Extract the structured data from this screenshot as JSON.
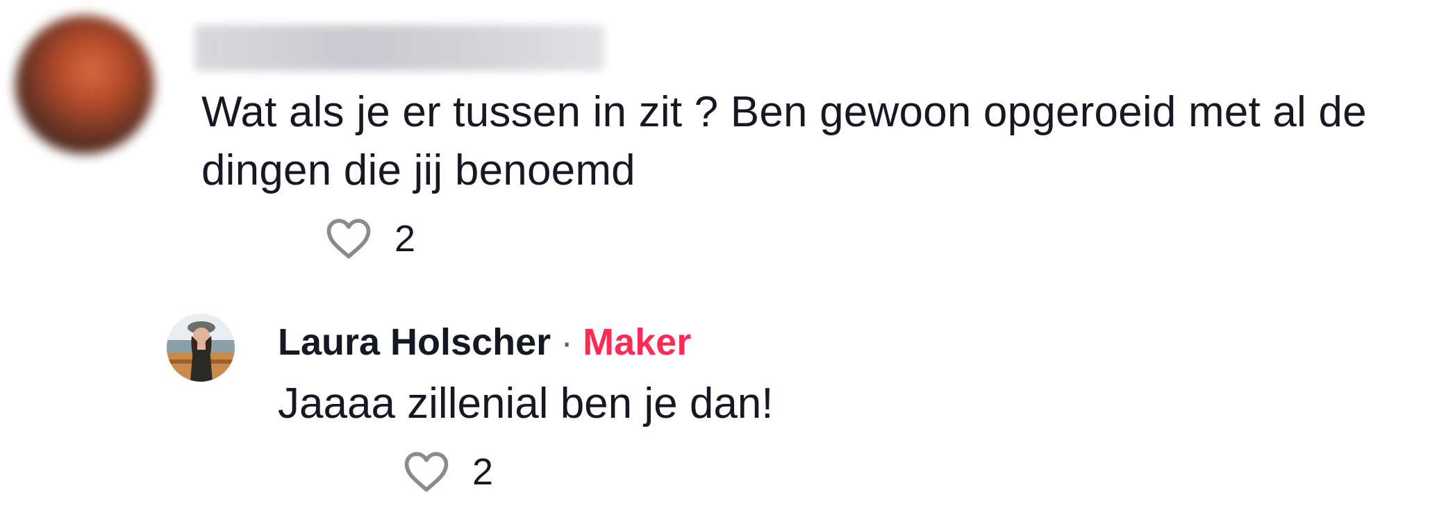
{
  "comment": {
    "text": "Wat als je er tussen in zit ? Ben gewoon opgeroeid met al de dingen die jij benoemd",
    "like_count": "2"
  },
  "reply": {
    "author": "Laura Holscher",
    "separator": "·",
    "badge": "Maker",
    "text": "Jaaaa zillenial ben je dan!",
    "like_count": "2"
  },
  "colors": {
    "text": "#161823",
    "badge": "#fe2c55",
    "heart_outline": "#8a8b91"
  },
  "icons": {
    "like": "heart-outline-icon"
  }
}
